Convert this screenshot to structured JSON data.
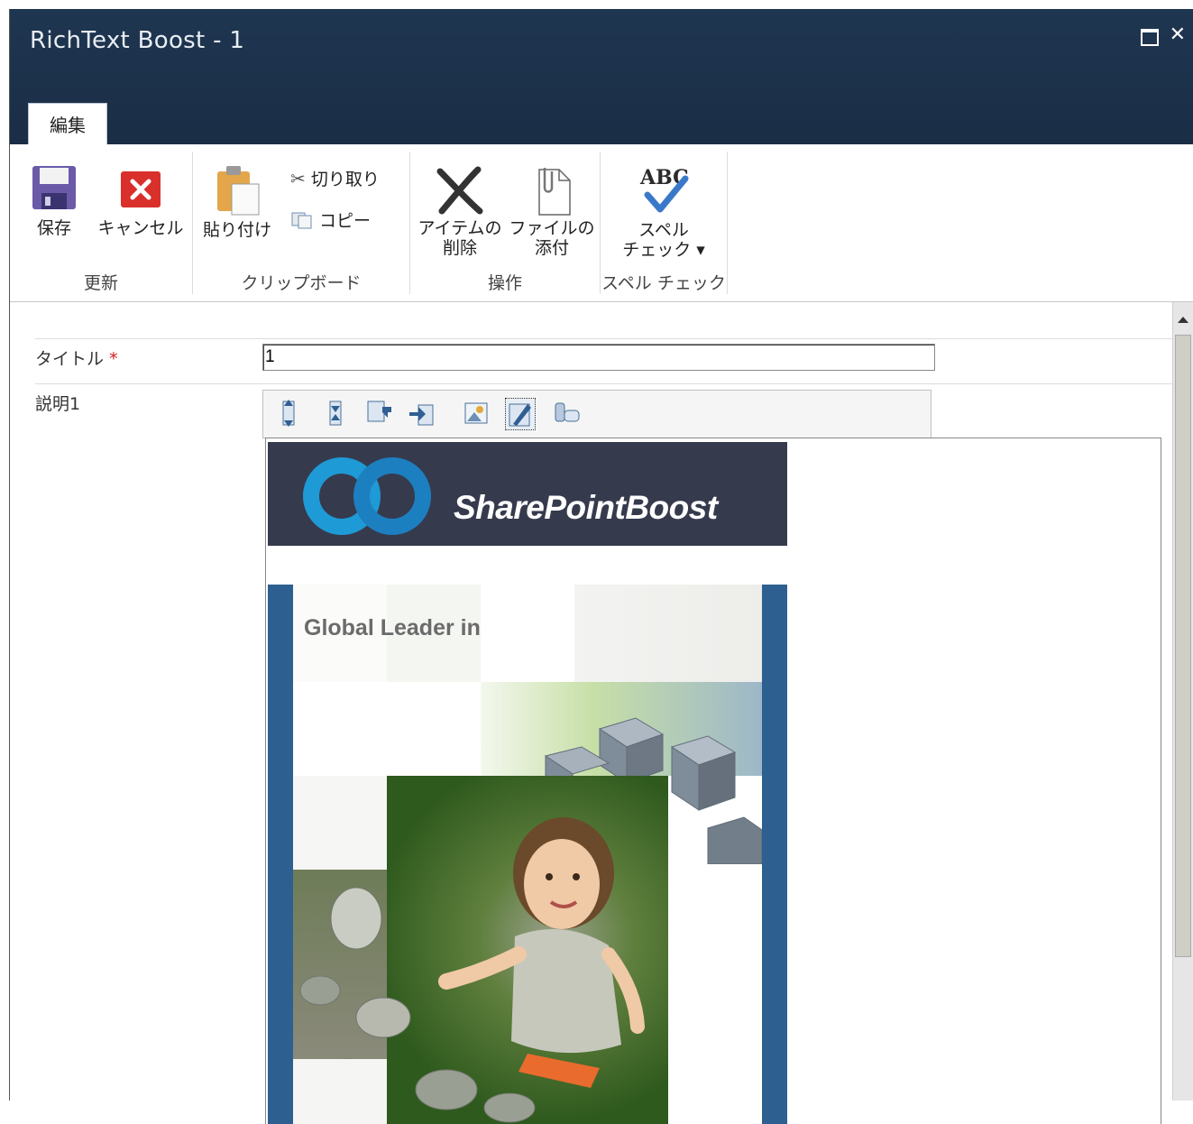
{
  "window": {
    "title": "RichText Boost - 1",
    "max_glyph": "",
    "close_glyph": "✕"
  },
  "tabs": [
    {
      "label": "編集"
    }
  ],
  "ribbon": {
    "groups": [
      {
        "label": "更新",
        "buttons": [
          {
            "label": "保存",
            "icon": "save-icon"
          },
          {
            "label": "キャンセル",
            "icon": "cancel-icon"
          }
        ]
      },
      {
        "label": "クリップボード",
        "buttons": [
          {
            "label": "貼り付け",
            "icon": "paste-icon"
          },
          {
            "label": "切り取り",
            "icon": "cut-icon"
          },
          {
            "label": "コピー",
            "icon": "copy-icon"
          }
        ]
      },
      {
        "label": "操作",
        "buttons": [
          {
            "label_line1": "アイテムの",
            "label_line2": "削除",
            "icon": "delete-item-icon"
          },
          {
            "label_line1": "ファイルの",
            "label_line2": "添付",
            "icon": "attach-file-icon"
          }
        ]
      },
      {
        "label": "スペル チェック",
        "buttons": [
          {
            "label_line1": "スペル",
            "label_line2": "チェック ▾",
            "icon": "spell-check-icon",
            "icon_text": "ABC"
          }
        ]
      }
    ]
  },
  "form": {
    "title_label": "タイトル",
    "required_mark": "*",
    "title_value": "1",
    "desc_label": "説明1"
  },
  "editor": {
    "toolbar_icons": [
      "insert-row-above-icon",
      "insert-row-below-icon",
      "insert-column-icon",
      "insert-cell-icon",
      "image-icon",
      "edit-html-icon",
      "link-icon"
    ],
    "logo_text": "SharePointBoost",
    "brochure_title": "Global Leader in"
  },
  "colors": {
    "titlebar": "#1f3651",
    "accent_blue": "#2e5f91",
    "logo_bg": "#363a4d",
    "logo_ring": "#1e9ad6"
  }
}
